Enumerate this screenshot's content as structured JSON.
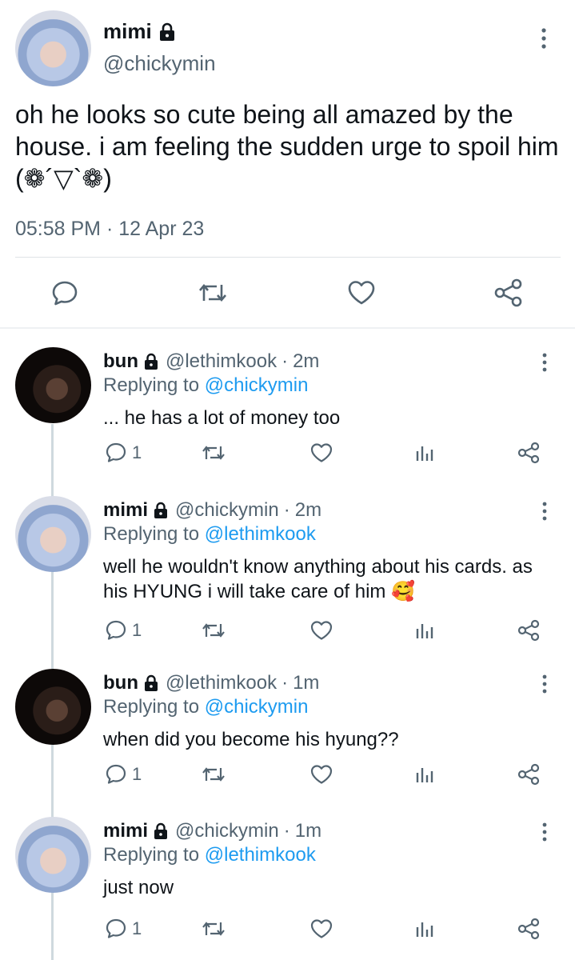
{
  "main_tweet": {
    "author_name": "mimi",
    "author_handle": "@chickymin",
    "text": "oh he looks so cute being all amazed by the house. i am feeling the sudden urge to spoil him (❁´▽`❁)",
    "time": "05:58 PM",
    "separator": "·",
    "date": "12 Apr 23",
    "icons": [
      "reply-icon",
      "retweet-icon",
      "like-icon",
      "share-icon"
    ]
  },
  "replies": [
    {
      "name": "bun",
      "handle": "@lethimkook",
      "dot": "·",
      "time": "2m",
      "replying_prefix": "Replying to",
      "replying_to": "@chickymin",
      "text": "... he has a lot of money too",
      "reply_count": "1",
      "avatar": "dark"
    },
    {
      "name": "mimi",
      "handle": "@chickymin",
      "dot": "·",
      "time": "2m",
      "replying_prefix": "Replying to",
      "replying_to": "@lethimkook",
      "text": "well he wouldn't know anything about his cards. as his HYUNG i will take care of him 🥰",
      "reply_count": "1",
      "avatar": "light"
    },
    {
      "name": "bun",
      "handle": "@lethimkook",
      "dot": "·",
      "time": "1m",
      "replying_prefix": "Replying to",
      "replying_to": "@chickymin",
      "text": "when did you become his hyung??",
      "reply_count": "1",
      "avatar": "dark"
    },
    {
      "name": "mimi",
      "handle": "@chickymin",
      "dot": "·",
      "time": "1m",
      "replying_prefix": "Replying to",
      "replying_to": "@lethimkook",
      "text": "just now",
      "reply_count": "1",
      "avatar": "light"
    }
  ],
  "colors": {
    "text": "#0f1419",
    "secondary": "#536471",
    "link": "#1d9bf0",
    "divider": "#dfe3e7"
  }
}
